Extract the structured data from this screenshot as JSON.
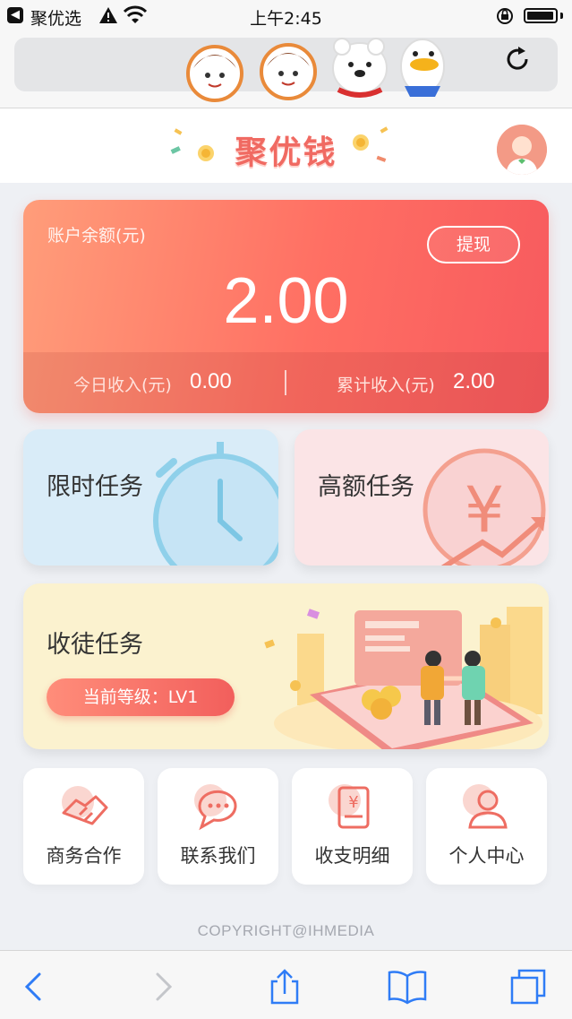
{
  "status_bar": {
    "carrier": "聚优选",
    "time": "上午2:45"
  },
  "app": {
    "title": "聚优钱"
  },
  "balance": {
    "label": "账户余额(元)",
    "amount": "2.00",
    "withdraw_label": "提现",
    "today_label": "今日收入(元)",
    "today_value": "0.00",
    "total_label": "累计收入(元)",
    "total_value": "2.00"
  },
  "tasks": {
    "limited": "限时任务",
    "high": "高额任务",
    "apprentice": "收徒任务",
    "level": "当前等级：LV1"
  },
  "quick_links": [
    {
      "label": "商务合作",
      "icon": "handshake-icon"
    },
    {
      "label": "联系我们",
      "icon": "chat-bubble-icon"
    },
    {
      "label": "收支明细",
      "icon": "yen-document-icon"
    },
    {
      "label": "个人中心",
      "icon": "user-icon"
    }
  ],
  "footer": {
    "copyright": "COPYRIGHT@IHMEDIA"
  },
  "colors": {
    "accent": "#f06a62",
    "balance_gradient_start": "#ff9d7a",
    "balance_gradient_end": "#f75a5e",
    "ios_blue": "#2f7cf6"
  }
}
